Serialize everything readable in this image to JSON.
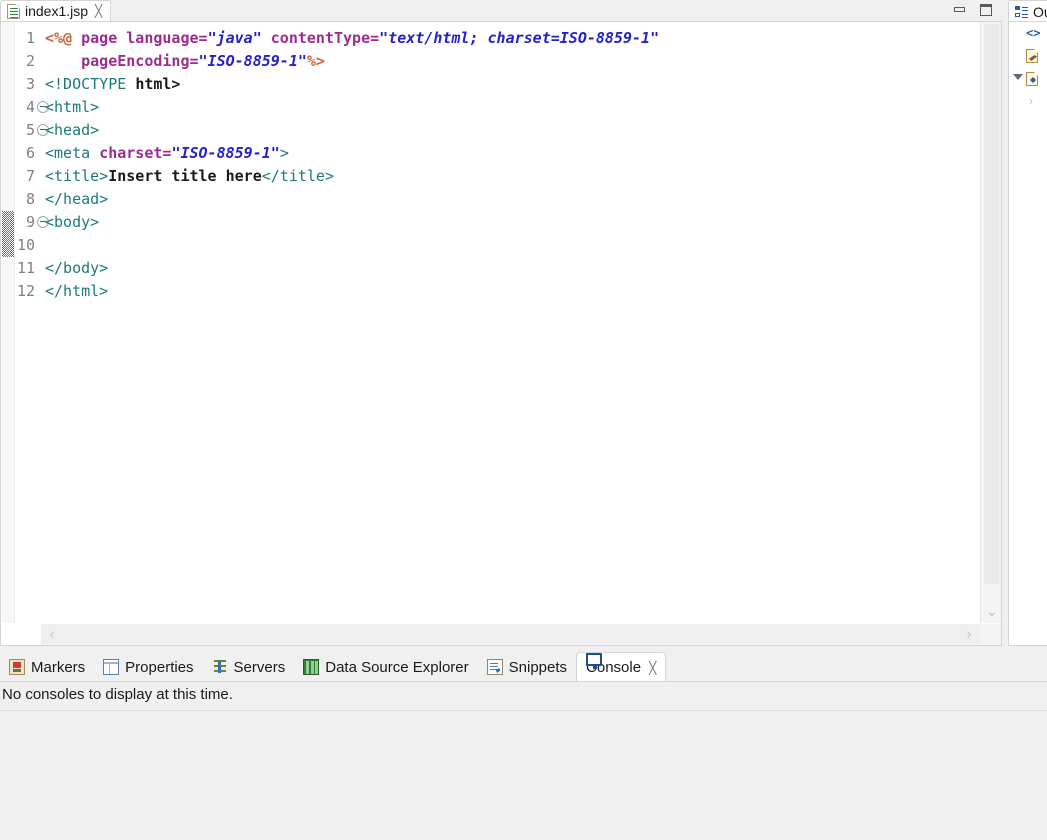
{
  "editor": {
    "tab": {
      "label": "index1.jsp",
      "icon": "jsp-file-icon",
      "close": "╳"
    },
    "window_controls": {
      "minimize": "minimize",
      "maximize": "maximize"
    },
    "lines": [
      {
        "num": "1",
        "fold": false,
        "changed": false,
        "tokens": [
          {
            "t": "<%@ ",
            "c": "t-dir"
          },
          {
            "t": "page ",
            "c": "t-attr"
          },
          {
            "t": "language=",
            "c": "t-attr"
          },
          {
            "t": "\"java\"",
            "c": "t-str"
          },
          {
            "t": " ",
            "c": "t-plain"
          },
          {
            "t": "contentType=",
            "c": "t-attr"
          },
          {
            "t": "\"text/html; charset=ISO-8859-1\"",
            "c": "t-str"
          }
        ]
      },
      {
        "num": "2",
        "fold": false,
        "changed": false,
        "tokens": [
          {
            "t": "    ",
            "c": "t-plain"
          },
          {
            "t": "pageEncoding=",
            "c": "t-attr"
          },
          {
            "t": "\"ISO-8859-1\"",
            "c": "t-str"
          },
          {
            "t": "%>",
            "c": "t-dir"
          }
        ]
      },
      {
        "num": "3",
        "fold": false,
        "changed": false,
        "tokens": [
          {
            "t": "<!DOCTYPE ",
            "c": "t-tag"
          },
          {
            "t": "html>",
            "c": "t-plain"
          }
        ]
      },
      {
        "num": "4",
        "fold": true,
        "changed": false,
        "tokens": [
          {
            "t": "<html>",
            "c": "t-tag"
          }
        ]
      },
      {
        "num": "5",
        "fold": true,
        "changed": false,
        "tokens": [
          {
            "t": "<head>",
            "c": "t-tag"
          }
        ]
      },
      {
        "num": "6",
        "fold": false,
        "changed": false,
        "tokens": [
          {
            "t": "<meta ",
            "c": "t-tag"
          },
          {
            "t": "charset=",
            "c": "t-attr"
          },
          {
            "t": "\"ISO-8859-1\"",
            "c": "t-str"
          },
          {
            "t": ">",
            "c": "t-tag"
          }
        ]
      },
      {
        "num": "7",
        "fold": false,
        "changed": false,
        "tokens": [
          {
            "t": "<title>",
            "c": "t-tag"
          },
          {
            "t": "Insert title here",
            "c": "t-plain"
          },
          {
            "t": "</title>",
            "c": "t-tag"
          }
        ]
      },
      {
        "num": "8",
        "fold": false,
        "changed": false,
        "tokens": [
          {
            "t": "</head>",
            "c": "t-tag"
          }
        ]
      },
      {
        "num": "9",
        "fold": true,
        "changed": true,
        "tokens": [
          {
            "t": "<body>",
            "c": "t-tag"
          }
        ]
      },
      {
        "num": "10",
        "fold": false,
        "changed": true,
        "tokens": [
          {
            "t": "",
            "c": "t-plain"
          }
        ]
      },
      {
        "num": "11",
        "fold": false,
        "changed": false,
        "tokens": [
          {
            "t": "</body>",
            "c": "t-tag"
          }
        ]
      },
      {
        "num": "12",
        "fold": false,
        "changed": false,
        "tokens": [
          {
            "t": "</html>",
            "c": "t-tag"
          }
        ]
      }
    ],
    "scrollbars": {
      "up_arrow": "⌃",
      "down_arrow": "⌄",
      "left_arrow": "‹",
      "right_arrow": "›"
    }
  },
  "outline": {
    "tab_label": "Ou",
    "tab_icon": "outline-icon",
    "rows": [
      {
        "icon": "angle-brackets-icon",
        "expandable": false
      },
      {
        "icon": "jsp-directive-icon",
        "expandable": false
      },
      {
        "icon": "html-document-icon",
        "expandable": true
      }
    ],
    "more_indicator": "›"
  },
  "bottom_panel": {
    "tabs": [
      {
        "label": "Markers",
        "icon": "markers-icon",
        "active": false
      },
      {
        "label": "Properties",
        "icon": "properties-icon",
        "active": false
      },
      {
        "label": "Servers",
        "icon": "servers-icon",
        "active": false
      },
      {
        "label": "Data Source Explorer",
        "icon": "data-source-explorer-icon",
        "active": false
      },
      {
        "label": "Snippets",
        "icon": "snippets-icon",
        "active": false
      },
      {
        "label": "Console",
        "icon": "console-icon",
        "active": true,
        "close": "╳"
      }
    ],
    "console_message": "No consoles to display at this time."
  },
  "colors": {
    "accent": "#2b5d9b",
    "string": "#2323c8",
    "tag": "#1c7a7a",
    "attribute": "#9b2d8f",
    "directive": "#c8663c",
    "changebar": "#3a77c9",
    "panel_bg": "#f0f0f0",
    "editor_bg": "#ffffff"
  }
}
